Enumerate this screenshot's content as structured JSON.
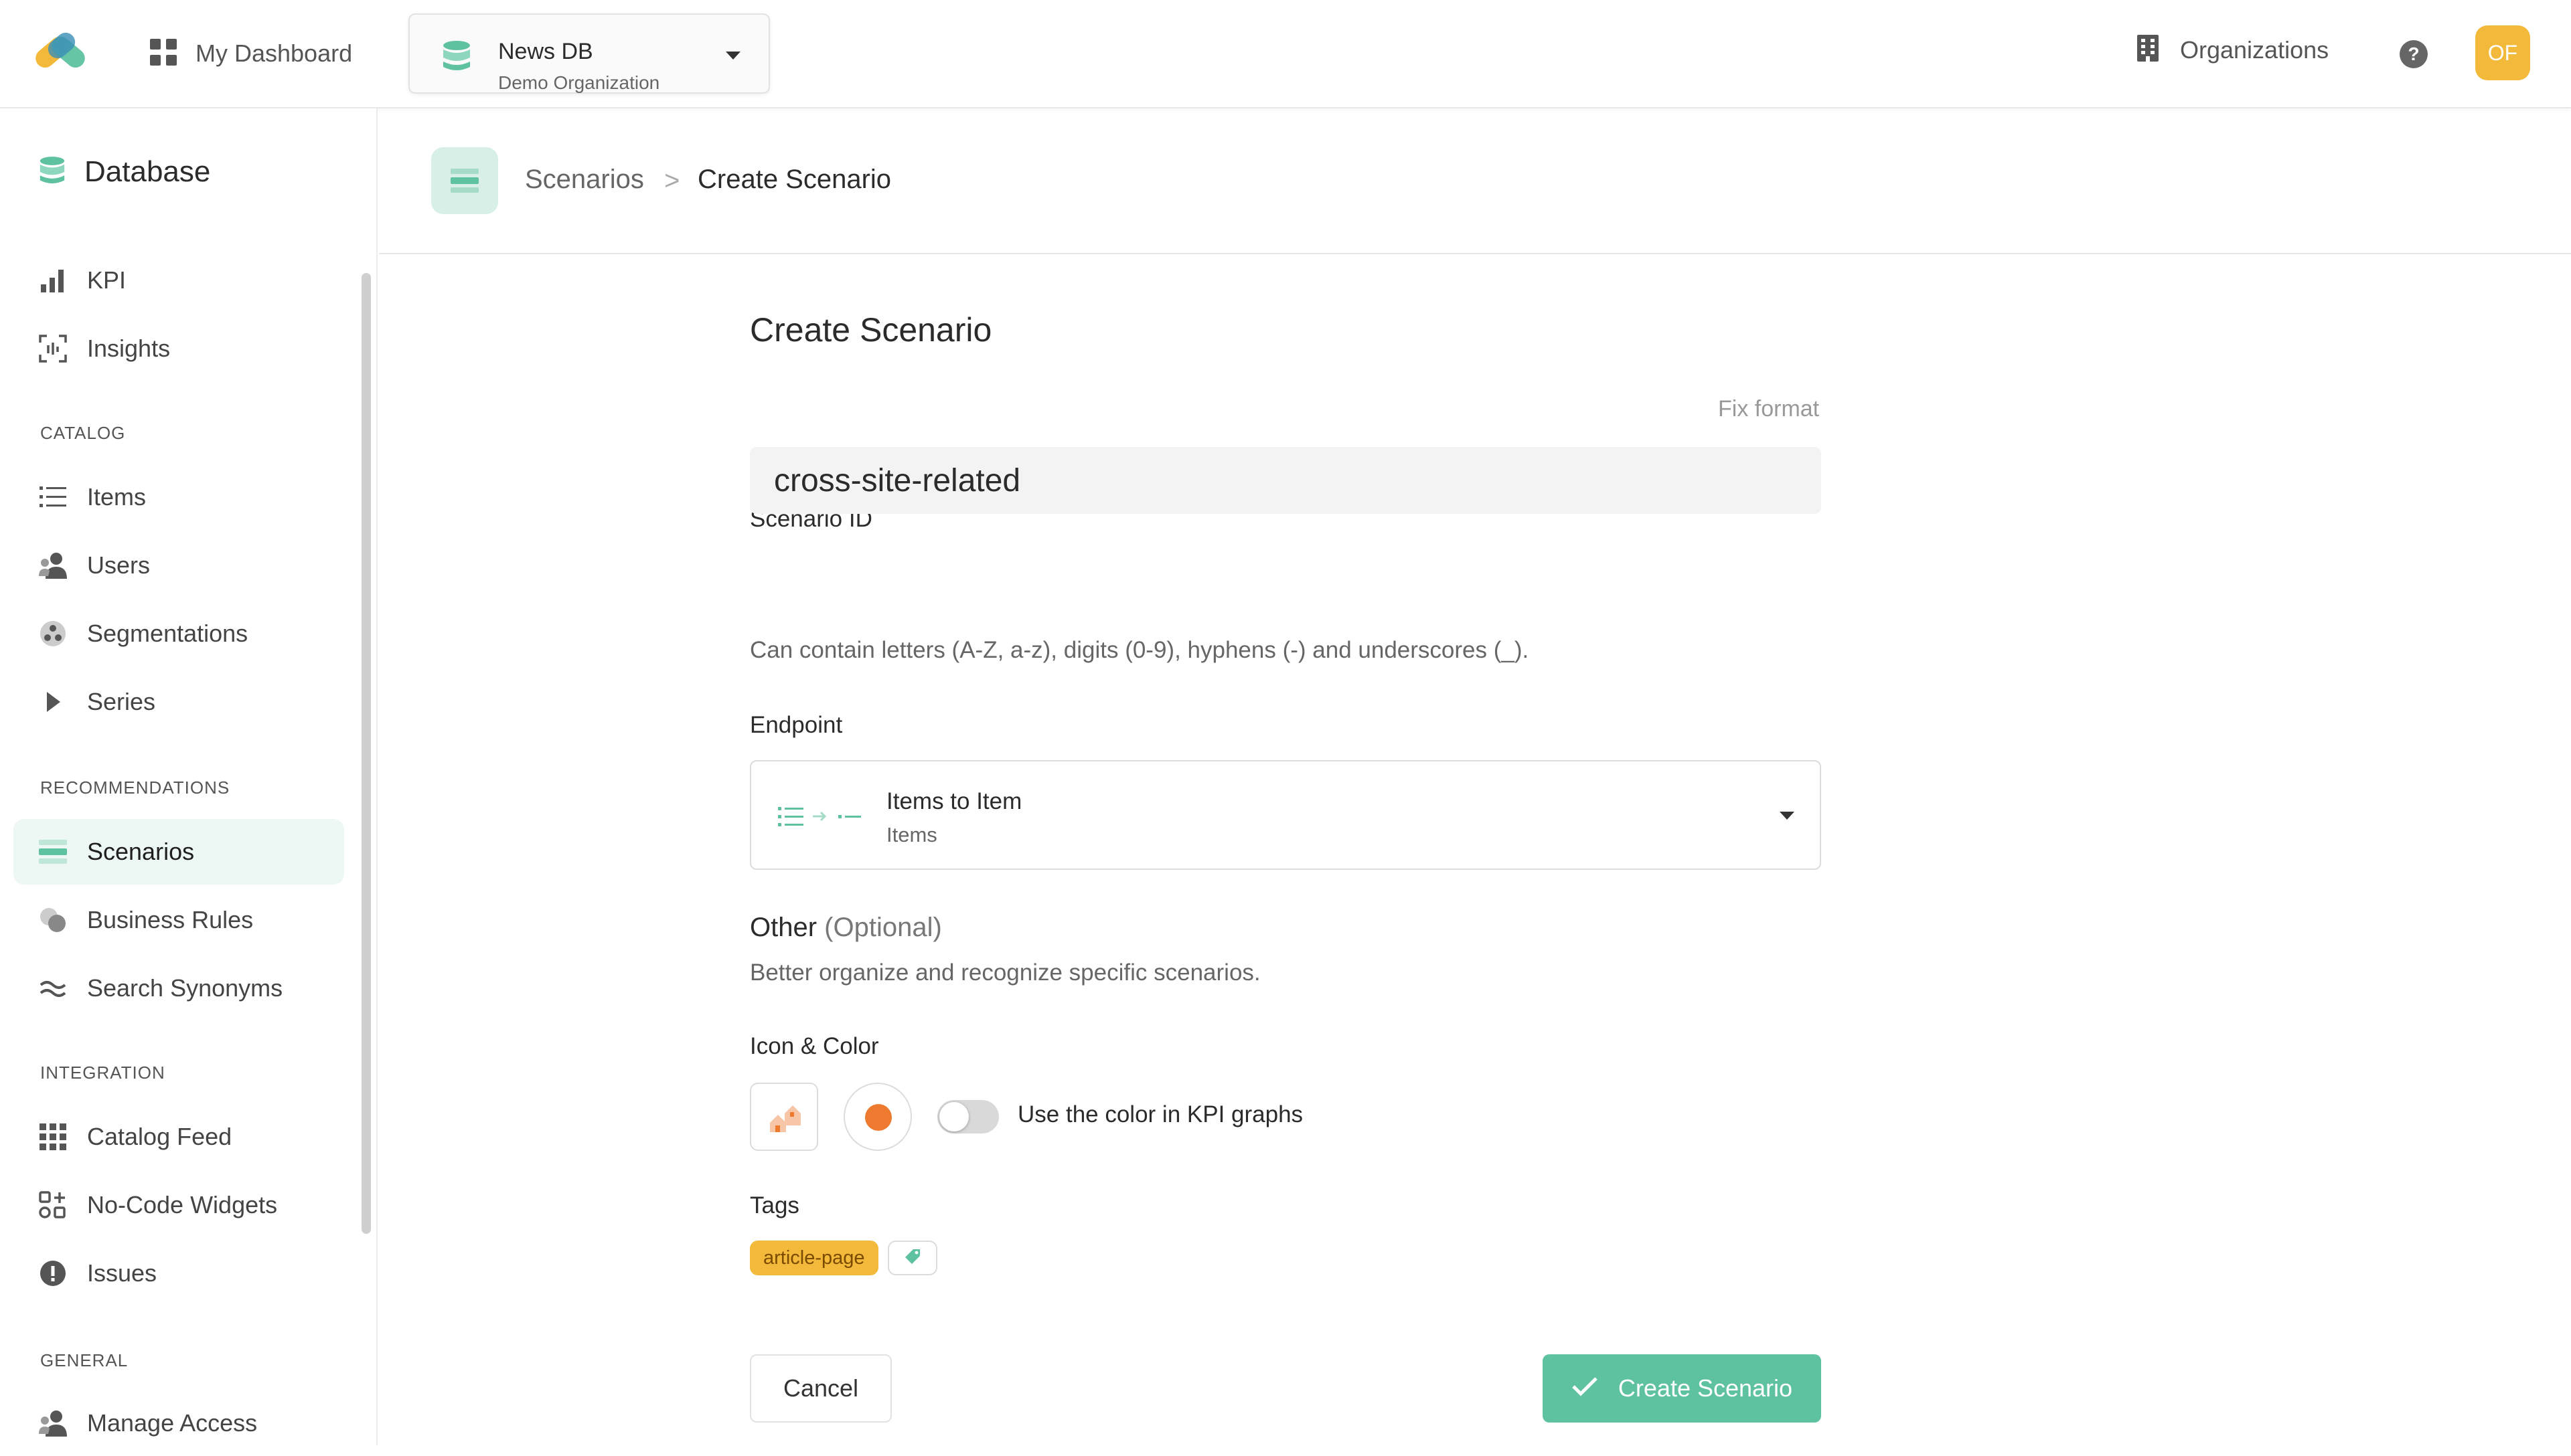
{
  "topbar": {
    "dashboard_label": "My Dashboard",
    "database": {
      "name": "News DB",
      "organization": "Demo Organization"
    },
    "organizations_label": "Organizations",
    "help_glyph": "?",
    "avatar_initials": "OF"
  },
  "colors": {
    "brand_green": "#5ec2a0",
    "active_bg": "#edf7f3",
    "tag_yellow": "#f3b93a",
    "scenario_color": "#ee7a30"
  },
  "sidebar": {
    "title": "Database",
    "items_top": [
      {
        "label": "KPI",
        "icon": "bar-chart-icon"
      },
      {
        "label": "Insights",
        "icon": "insights-icon"
      }
    ],
    "catalog": {
      "heading": "CATALOG",
      "items": [
        {
          "label": "Items",
          "icon": "list-icon"
        },
        {
          "label": "Users",
          "icon": "users-icon"
        },
        {
          "label": "Segmentations",
          "icon": "segmentations-icon"
        },
        {
          "label": "Series",
          "icon": "play-icon"
        }
      ]
    },
    "recommendations": {
      "heading": "RECOMMENDATIONS",
      "items": [
        {
          "label": "Scenarios",
          "icon": "scenarios-icon",
          "active": true
        },
        {
          "label": "Business Rules",
          "icon": "business-rules-icon"
        },
        {
          "label": "Search Synonyms",
          "icon": "approx-icon"
        }
      ]
    },
    "integration": {
      "heading": "INTEGRATION",
      "items": [
        {
          "label": "Catalog Feed",
          "icon": "grid-icon"
        },
        {
          "label": "No-Code Widgets",
          "icon": "widgets-icon"
        },
        {
          "label": "Issues",
          "icon": "alert-icon"
        }
      ]
    },
    "general": {
      "heading": "GENERAL",
      "items": [
        {
          "label": "Manage Access",
          "icon": "users-icon"
        }
      ]
    }
  },
  "breadcrumb": {
    "parent": "Scenarios",
    "separator": ">",
    "current": "Create Scenario"
  },
  "form": {
    "title": "Create Scenario",
    "scenario_id": {
      "label": "Scenario ID",
      "fix_format": "Fix format",
      "value": "cross-site-related",
      "hint": "Can contain letters (A-Z, a-z), digits (0-9), hyphens (-) and underscores (_)."
    },
    "endpoint": {
      "label": "Endpoint",
      "title": "Items to Item",
      "subtitle": "Items"
    },
    "other": {
      "title": "Other",
      "optional": "(Optional)",
      "description": "Better organize and recognize specific scenarios."
    },
    "icon_color": {
      "label": "Icon & Color",
      "toggle_label": "Use the color in KPI graphs",
      "toggle_on": false
    },
    "tags": {
      "label": "Tags",
      "items": [
        "article-page"
      ]
    },
    "cancel_label": "Cancel",
    "submit_label": "Create Scenario"
  }
}
